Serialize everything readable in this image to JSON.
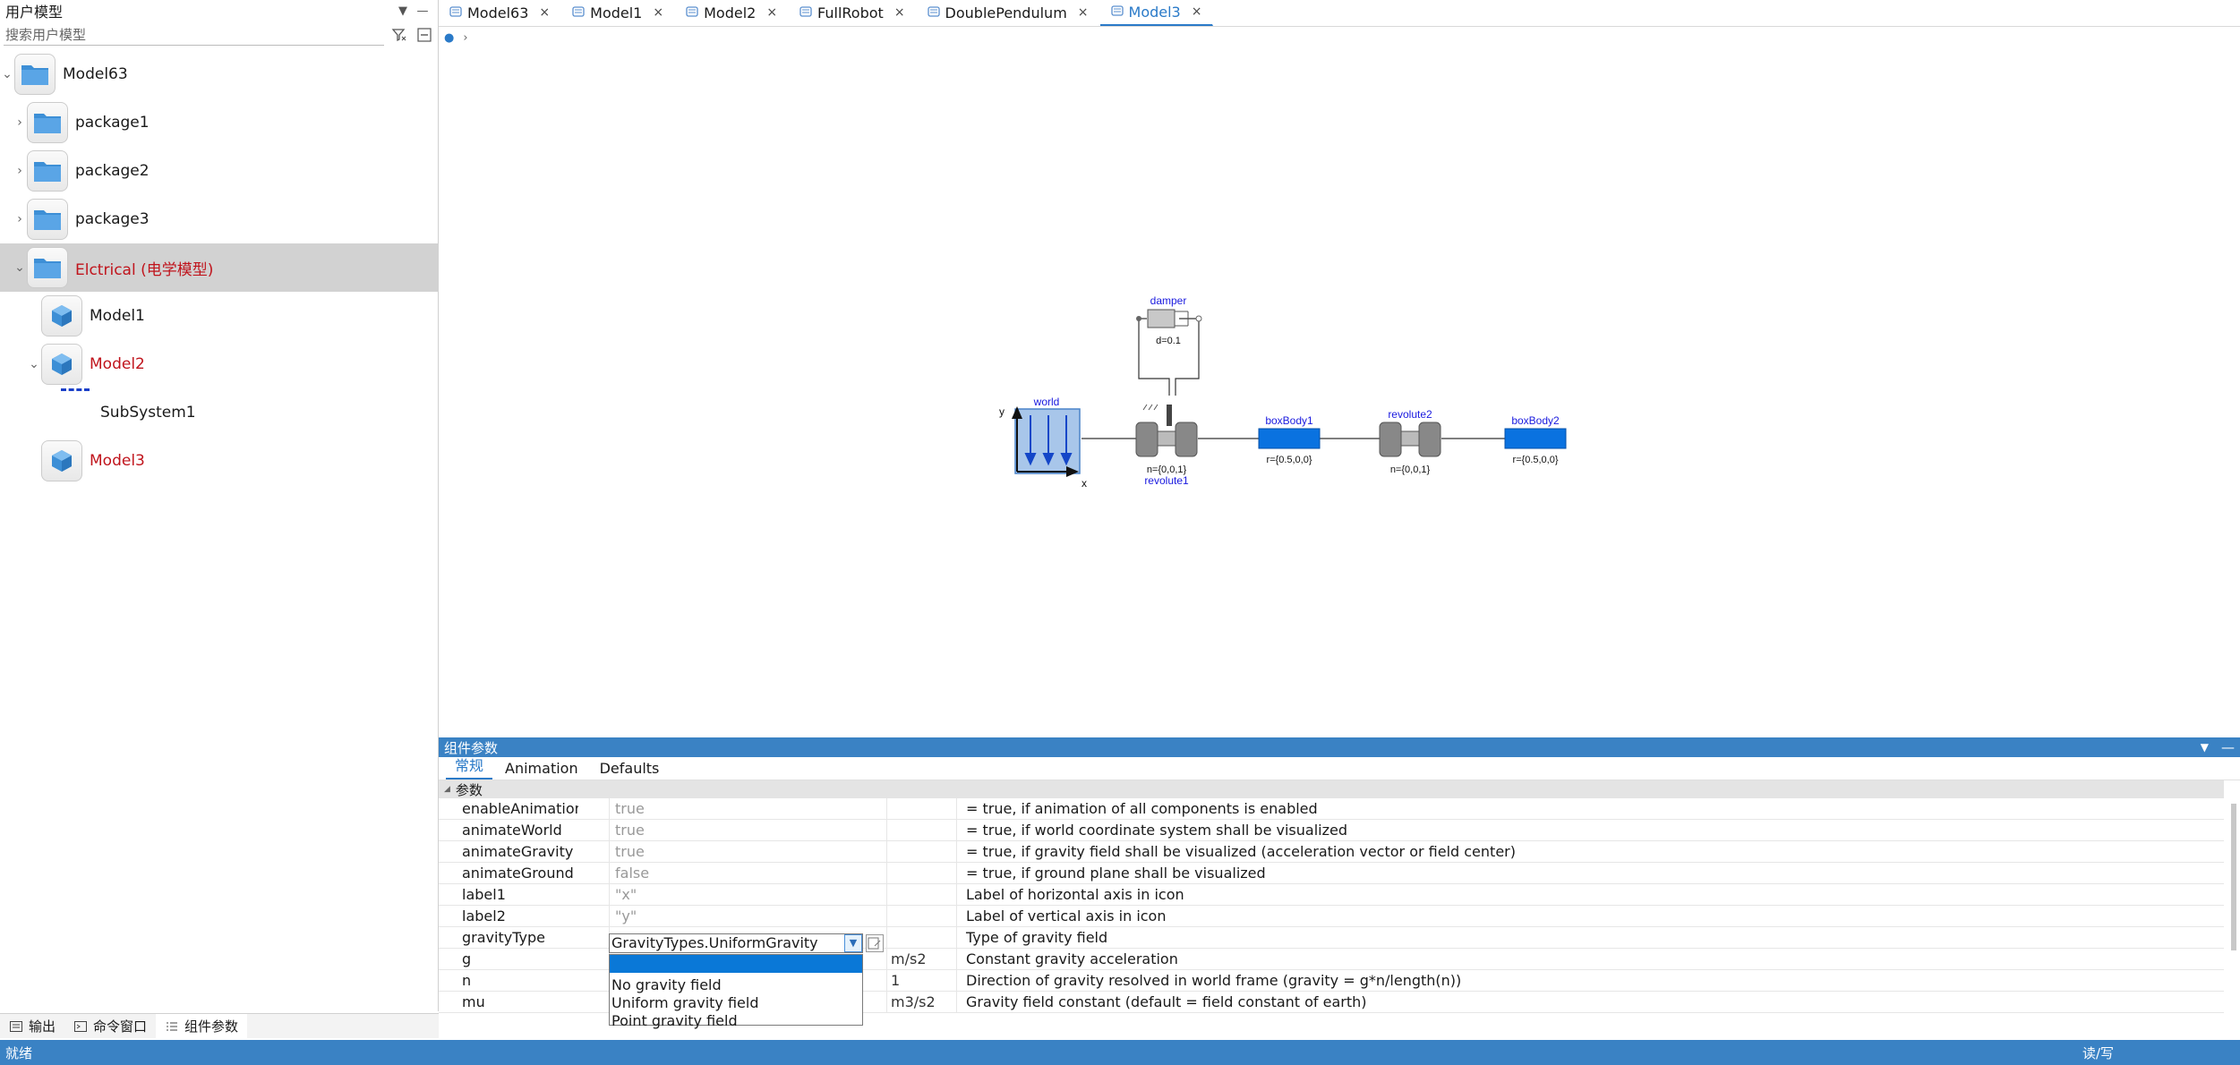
{
  "left_panel": {
    "title": "用户模型",
    "search_placeholder": "搜索用户模型",
    "tree": [
      {
        "label": "Model63",
        "icon": "folder-icon",
        "expanded": true
      },
      {
        "label": "package1",
        "icon": "folder-icon"
      },
      {
        "label": "package2",
        "icon": "folder-icon"
      },
      {
        "label": "package3",
        "icon": "folder-icon"
      },
      {
        "label": "Elctrical (电学模型)",
        "icon": "folder-icon",
        "expanded": true,
        "selected": true
      },
      {
        "label": "Model1",
        "icon": "cube-icon"
      },
      {
        "label": "Model2",
        "icon": "cube-icon",
        "expanded": true
      },
      {
        "label": "SubSystem1",
        "icon": "subsystem-icon"
      },
      {
        "label": "Model3",
        "icon": "cube-icon"
      }
    ]
  },
  "bottom_tabs": [
    {
      "label": "输出"
    },
    {
      "label": "命令窗口"
    },
    {
      "label": "组件参数"
    }
  ],
  "tabs": [
    {
      "label": "Model63"
    },
    {
      "label": "Model1"
    },
    {
      "label": "Model2"
    },
    {
      "label": "FullRobot"
    },
    {
      "label": "DoublePendulum"
    },
    {
      "label": "Model3",
      "active": true
    }
  ],
  "diagram": {
    "world": {
      "name": "world",
      "axis_x": "x",
      "axis_y": "y"
    },
    "damper": {
      "name": "damper",
      "param": "d=0.1"
    },
    "revolute1": {
      "name": "revolute1",
      "param": "n={0,0,1}"
    },
    "boxBody1": {
      "name": "boxBody1",
      "param": "r={0.5,0,0}"
    },
    "revolute2": {
      "name": "revolute2",
      "param": "n={0,0,1}"
    },
    "boxBody2": {
      "name": "boxBody2",
      "param": "r={0.5,0,0}"
    }
  },
  "properties": {
    "title": "组件参数",
    "tabs": [
      {
        "label": "常规",
        "active": true
      },
      {
        "label": "Animation"
      },
      {
        "label": "Defaults"
      }
    ],
    "group": "参数",
    "rows": [
      {
        "name": "enableAnimation",
        "value": "true",
        "unit": "",
        "desc": "= true, if animation of all components is enabled"
      },
      {
        "name": "animateWorld",
        "value": "true",
        "unit": "",
        "desc": "= true, if world coordinate system shall be visualized"
      },
      {
        "name": "animateGravity",
        "value": "true",
        "unit": "",
        "desc": "= true, if gravity field shall be visualized (acceleration vector or field center)"
      },
      {
        "name": "animateGround",
        "value": "false",
        "unit": "",
        "desc": "= true, if ground plane shall be visualized"
      },
      {
        "name": "label1",
        "value": "\"x\"",
        "unit": "",
        "desc": "Label of horizontal axis in icon"
      },
      {
        "name": "label2",
        "value": "\"y\"",
        "unit": "",
        "desc": "Label of vertical axis in icon"
      },
      {
        "name": "gravityType",
        "value": "",
        "unit": "",
        "desc": "Type of gravity field"
      },
      {
        "name": "g",
        "value": "",
        "unit": "m/s2",
        "desc": "Constant gravity acceleration"
      },
      {
        "name": "n",
        "value": "",
        "unit": "1",
        "desc": "Direction of gravity resolved in world frame (gravity = g*n/length(n))"
      },
      {
        "name": "mu",
        "value": "",
        "unit": "m3/s2",
        "desc": "Gravity field constant (default = field constant of earth)"
      }
    ],
    "combo_value": "GravityTypes.UniformGravity",
    "dropdown_options": [
      "",
      "No gravity field",
      "Uniform gravity field",
      "Point gravity field"
    ]
  },
  "status": {
    "left": "就绪",
    "right": "读/写"
  },
  "colors": {
    "accent": "#3a82c4",
    "selected_bg": "#d2d2d2",
    "red_label": "#c0141c",
    "body_blue": "#0a72e0"
  }
}
